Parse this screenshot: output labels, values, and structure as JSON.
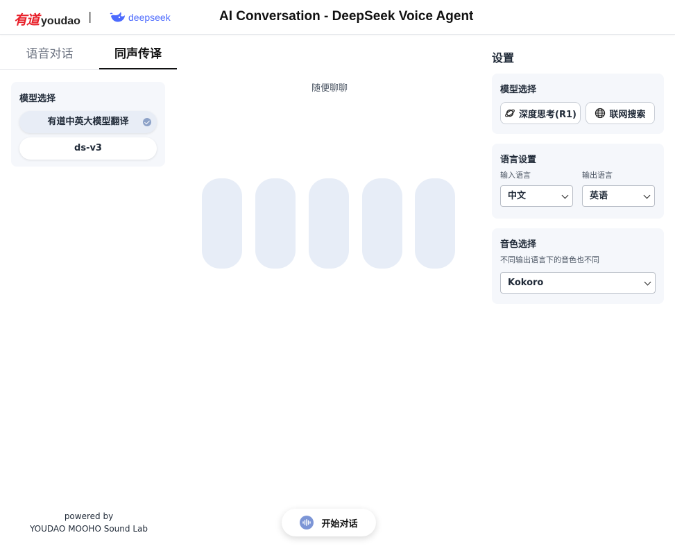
{
  "header": {
    "youdao_cn": "有道",
    "youdao_en": "youdao",
    "separator": "|",
    "deepseek": "deepseek",
    "title": "AI Conversation - DeepSeek Voice Agent"
  },
  "tabs": [
    {
      "label": "语音对话",
      "active": false
    },
    {
      "label": "同声传译",
      "active": true
    }
  ],
  "model_panel": {
    "label": "模型选择",
    "options": [
      {
        "label": "有道中英大模型翻译",
        "selected": true
      },
      {
        "label": "ds-v3",
        "selected": false
      }
    ]
  },
  "center": {
    "hint": "随便聊聊",
    "bars": 5
  },
  "settings": {
    "title": "设置",
    "model_card": {
      "label": "模型选择",
      "deep_think": "深度思考(R1)",
      "web_search": "联网搜索"
    },
    "language_card": {
      "label": "语言设置",
      "input_label": "输入语言",
      "input_value": "中文",
      "output_label": "输出语言",
      "output_value": "英语"
    },
    "voice_card": {
      "label": "音色选择",
      "hint": "不同输出语言下的音色也不同",
      "value": "Kokoro"
    }
  },
  "footer": {
    "powered_by": "powered by",
    "lab": "YOUDAO MOOHO Sound Lab",
    "start_button": "开始对话"
  },
  "colors": {
    "youdao_red": "#e8202a",
    "deepseek_blue": "#4d6bfe",
    "bar_fill": "#e7edf7",
    "panel_bg": "#f5f7fb",
    "mic_accent": "#7c95d6"
  }
}
